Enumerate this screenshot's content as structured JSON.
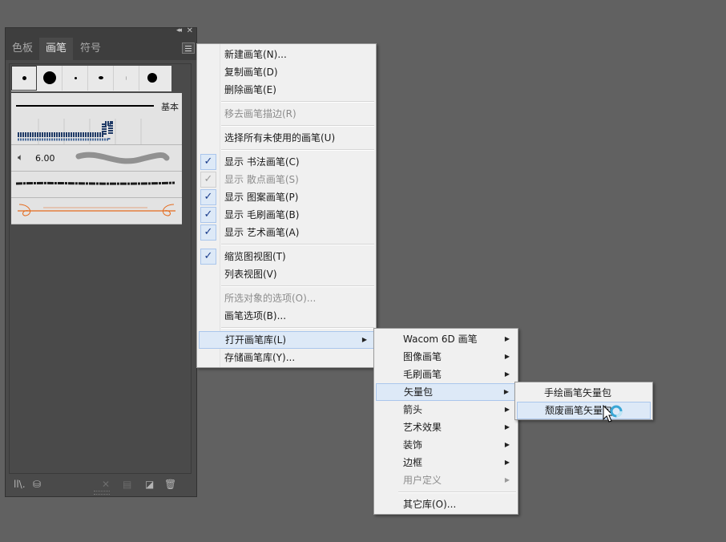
{
  "colors": {
    "canvas": "#616161",
    "panel": "#4a4a4a",
    "menu_bg": "#f0f0f0",
    "menu_highlight": "#dde9f7",
    "check_color": "#1b3e8c",
    "brush_orange": "#e46b1e"
  },
  "panel": {
    "tabs": [
      "色板",
      "画笔",
      "符号"
    ],
    "active_tab": "画笔",
    "basic_label": "基本",
    "stroke_size": "6.00",
    "footer_icons": [
      "brush-library-icon",
      "libraries-panel-icon",
      "remove-stroke-icon",
      "brush-options-icon",
      "new-brush-icon",
      "delete-brush-icon"
    ]
  },
  "main_menu": {
    "items": [
      {
        "label": "新建画笔(N)...",
        "enabled": true
      },
      {
        "label": "复制画笔(D)",
        "enabled": true
      },
      {
        "label": "删除画笔(E)",
        "enabled": true
      },
      {
        "label": "移去画笔描边(R)",
        "enabled": false
      },
      {
        "label": "选择所有未使用的画笔(U)",
        "enabled": true
      },
      {
        "label": "显示 书法画笔(C)",
        "enabled": true,
        "checked": true
      },
      {
        "label": "显示 散点画笔(S)",
        "enabled": false,
        "checked": true
      },
      {
        "label": "显示 图案画笔(P)",
        "enabled": true,
        "checked": true
      },
      {
        "label": "显示 毛刷画笔(B)",
        "enabled": true,
        "checked": true
      },
      {
        "label": "显示 艺术画笔(A)",
        "enabled": true,
        "checked": true
      },
      {
        "label": "缩览图视图(T)",
        "enabled": true,
        "checked": true
      },
      {
        "label": "列表视图(V)",
        "enabled": true
      },
      {
        "label": "所选对象的选项(O)...",
        "enabled": false
      },
      {
        "label": "画笔选项(B)...",
        "enabled": true
      },
      {
        "label": "打开画笔库(L)",
        "enabled": true,
        "submenu": true,
        "highlighted": true
      },
      {
        "label": "存储画笔库(Y)...",
        "enabled": true
      }
    ]
  },
  "library_menu": {
    "items": [
      {
        "label": "Wacom 6D 画笔",
        "enabled": true,
        "submenu": true
      },
      {
        "label": "图像画笔",
        "enabled": true,
        "submenu": true
      },
      {
        "label": "毛刷画笔",
        "enabled": true,
        "submenu": true
      },
      {
        "label": "矢量包",
        "enabled": true,
        "submenu": true,
        "highlighted": true
      },
      {
        "label": "箭头",
        "enabled": true,
        "submenu": true
      },
      {
        "label": "艺术效果",
        "enabled": true,
        "submenu": true
      },
      {
        "label": "装饰",
        "enabled": true,
        "submenu": true
      },
      {
        "label": "边框",
        "enabled": true,
        "submenu": true
      },
      {
        "label": "用户定义",
        "enabled": false,
        "submenu": true
      },
      {
        "label": "其它库(O)...",
        "enabled": true
      }
    ]
  },
  "vector_pack_menu": {
    "items": [
      {
        "label": "手绘画笔矢量包",
        "enabled": true
      },
      {
        "label": "颓废画笔矢量包",
        "enabled": true,
        "highlighted": true
      }
    ]
  }
}
